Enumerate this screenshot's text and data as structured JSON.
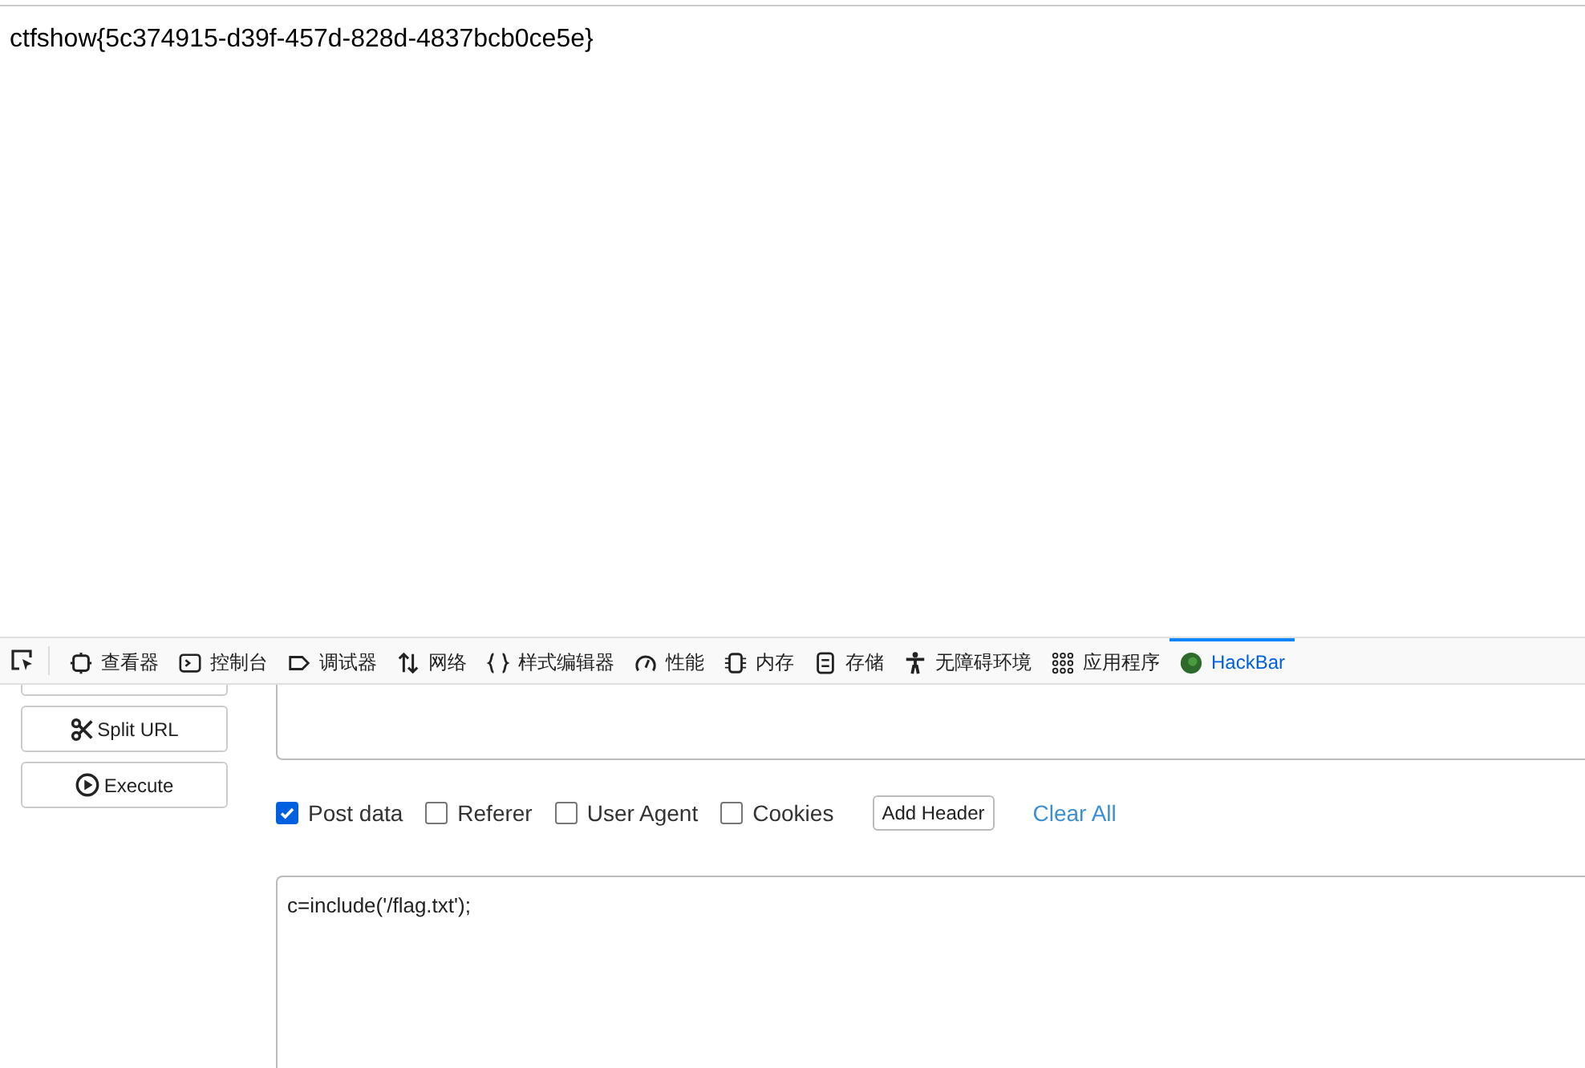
{
  "page": {
    "text": "ctfshow{5c374915-d39f-457d-828d-4837bcb0ce5e}"
  },
  "devtools": {
    "tabs": [
      {
        "kind": "inspector",
        "label": "查看器",
        "selected": false
      },
      {
        "kind": "console",
        "label": "控制台",
        "selected": false
      },
      {
        "kind": "debugger",
        "label": "调试器",
        "selected": false
      },
      {
        "kind": "network",
        "label": "网络",
        "selected": false
      },
      {
        "kind": "style",
        "label": "样式编辑器",
        "selected": false
      },
      {
        "kind": "performance",
        "label": "性能",
        "selected": false
      },
      {
        "kind": "memory",
        "label": "内存",
        "selected": false
      },
      {
        "kind": "storage",
        "label": "存储",
        "selected": false
      },
      {
        "kind": "accessibility",
        "label": "无障碍环境",
        "selected": false
      },
      {
        "kind": "apps",
        "label": "应用程序",
        "selected": false
      },
      {
        "kind": "hackbar",
        "label": "HackBar",
        "selected": true
      }
    ]
  },
  "hackbar": {
    "buttons": [
      {
        "kind": "split",
        "label": "Split URL"
      },
      {
        "kind": "execute",
        "label": "Execute"
      }
    ],
    "options": [
      {
        "label": "Post data",
        "checked": true
      },
      {
        "label": "Referer",
        "checked": false
      },
      {
        "label": "User Agent",
        "checked": false
      },
      {
        "label": "Cookies",
        "checked": false
      }
    ],
    "add_header": "Add Header",
    "clear_all": "Clear All",
    "post_body": "c=include('/flag.txt');"
  }
}
